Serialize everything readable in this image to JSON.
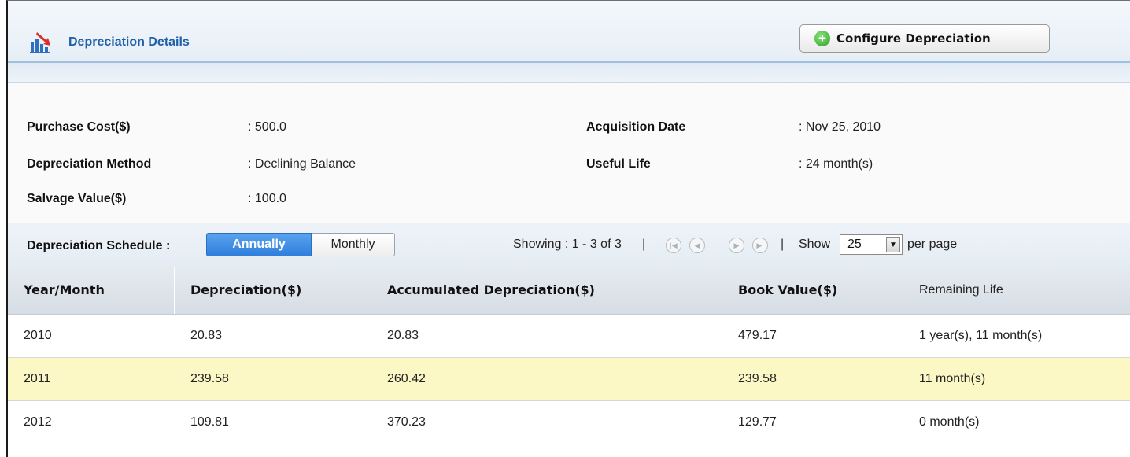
{
  "header": {
    "title": "Depreciation Details",
    "icon": "depreciation-chart-icon",
    "configure_button": "Configure Depreciation",
    "configure_icon": "plus-circle-icon"
  },
  "details": {
    "purchase_cost": {
      "label": "Purchase Cost($)",
      "value": ": 500.0"
    },
    "depreciation_method": {
      "label": "Depreciation Method",
      "value": ": Declining Balance"
    },
    "salvage_value": {
      "label": "Salvage Value($)",
      "value": ": 100.0"
    },
    "acquisition_date": {
      "label": "Acquisition Date",
      "value": ": Nov 25, 2010"
    },
    "useful_life": {
      "label": "Useful Life",
      "value": ": 24 month(s)"
    }
  },
  "schedule": {
    "label": "Depreciation Schedule :",
    "annually": "Annually",
    "monthly": "Monthly",
    "selected": "Annually"
  },
  "pagination": {
    "showing": "Showing : 1 - 3 of 3",
    "separator": "|",
    "show_label": "Show",
    "per_page_value": "25",
    "per_page_label": "per page"
  },
  "table": {
    "columns": [
      "Year/Month",
      "Depreciation($)",
      "Accumulated Depreciation($)",
      "Book Value($)",
      "Remaining Life"
    ],
    "rows": [
      [
        "2010",
        "20.83",
        "20.83",
        "479.17",
        "1 year(s), 11 month(s)"
      ],
      [
        "2011",
        "239.58",
        "260.42",
        "239.58",
        "11 month(s)"
      ],
      [
        "2012",
        "109.81",
        "370.23",
        "129.77",
        "0 month(s)"
      ]
    ],
    "highlighted_row": 1
  },
  "colors": {
    "title_blue": "#1f5fa8",
    "annual_button": "#3d8fe6",
    "highlight_row": "#fbf8c6"
  }
}
